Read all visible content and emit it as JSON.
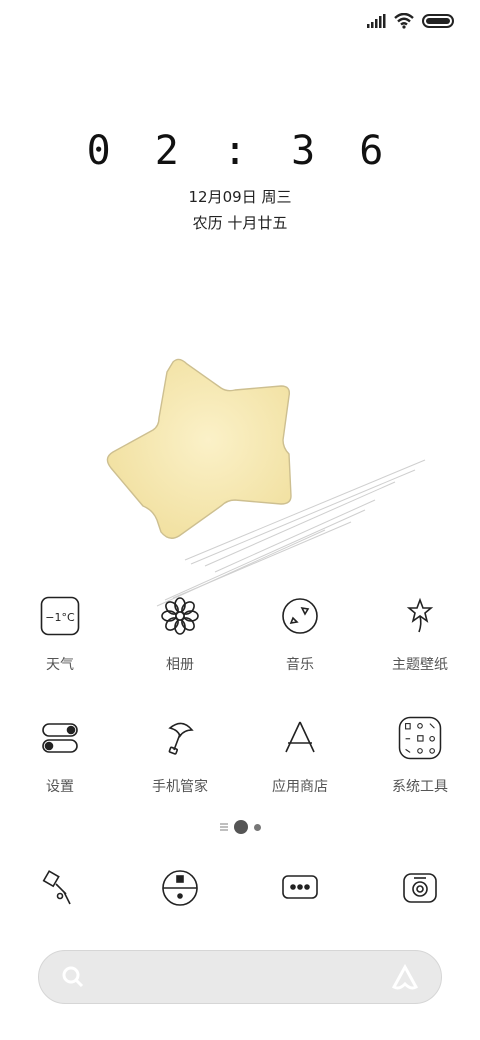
{
  "status_bar": {
    "icons": [
      "signal-icon",
      "wifi-icon",
      "battery-icon"
    ]
  },
  "clock": {
    "time": "0 2 : 3 6"
  },
  "date": {
    "line1": "12月09日 周三",
    "line2": "农历 十月廿五"
  },
  "apps_row1": [
    {
      "label": "天气",
      "icon": "weather-icon",
      "temp": "−1°C"
    },
    {
      "label": "相册",
      "icon": "flower-icon"
    },
    {
      "label": "音乐",
      "icon": "music-disc-icon"
    },
    {
      "label": "主题壁纸",
      "icon": "star-balloon-icon"
    }
  ],
  "apps_row2": [
    {
      "label": "设置",
      "icon": "toggle-icon"
    },
    {
      "label": "手机管家",
      "icon": "umbrella-icon"
    },
    {
      "label": "应用商店",
      "icon": "app-store-icon"
    },
    {
      "label": "系统工具",
      "icon": "folder-icon"
    }
  ],
  "dock": [
    {
      "icon": "phone-icon"
    },
    {
      "icon": "browser-icon"
    },
    {
      "icon": "messages-icon"
    },
    {
      "icon": "camera-icon"
    }
  ],
  "page_indicator": {
    "pages": 2,
    "active": 1
  },
  "search": {
    "icons": [
      "search-icon",
      "assistant-icon"
    ]
  }
}
